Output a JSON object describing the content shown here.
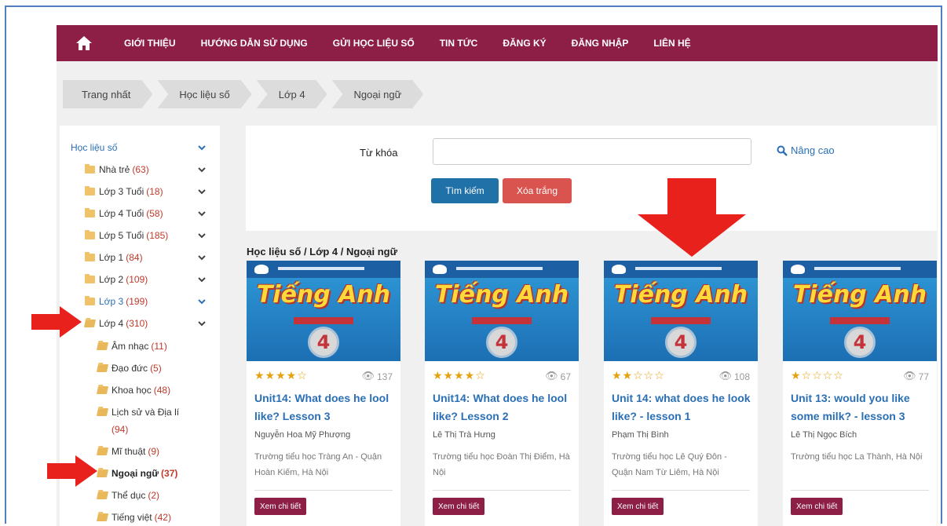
{
  "nav": {
    "items": [
      "GIỚI THIỆU",
      "HƯỚNG DẪN SỬ DỤNG",
      "GỬI HỌC LIỆU SỐ",
      "TIN TỨC",
      "ĐĂNG KÝ",
      "ĐĂNG NHẬP",
      "LIÊN HỆ"
    ]
  },
  "breadcrumb": [
    "Trang nhất",
    "Học liệu số",
    "Lớp 4",
    "Ngoại ngữ"
  ],
  "sidebar": {
    "root": "Học liệu số",
    "items": [
      {
        "label": "Nhà trẻ",
        "count": "(63)"
      },
      {
        "label": "Lớp 3 Tuổi",
        "count": "(18)"
      },
      {
        "label": "Lớp 4 Tuổi",
        "count": "(58)"
      },
      {
        "label": "Lớp 5 Tuổi",
        "count": "(185)"
      },
      {
        "label": "Lớp 1",
        "count": "(84)"
      },
      {
        "label": "Lớp 2",
        "count": "(109)"
      },
      {
        "label": "Lớp 3",
        "count": "(199)"
      },
      {
        "label": "Lớp 4",
        "count": "(310)"
      }
    ],
    "subitems": [
      {
        "label": "Âm nhạc",
        "count": "(11)"
      },
      {
        "label": "Đạo đức",
        "count": "(5)"
      },
      {
        "label": "Khoa học",
        "count": "(48)"
      },
      {
        "label": "Lịch sử và Địa lí",
        "count": "(94)"
      },
      {
        "label": "Mĩ thuật",
        "count": "(9)"
      },
      {
        "label": "Ngoại ngữ",
        "count": "(37)"
      },
      {
        "label": "Thể dục",
        "count": "(2)"
      },
      {
        "label": "Tiếng việt",
        "count": "(42)"
      }
    ]
  },
  "search": {
    "keyword_label": "Từ khóa",
    "keyword_value": "",
    "search_button": "Tìm kiếm",
    "clear_button": "Xóa trắng",
    "advanced_link": "Nâng cao"
  },
  "section_title": "Học liệu số / Lớp 4 / Ngoại ngữ",
  "cards": [
    {
      "cover_title": "Tiếng Anh",
      "cover_grade": "4",
      "rating": 4,
      "stars": "★★★★☆",
      "views": "137",
      "title": "Unit14: What does he lool like? Lesson 3",
      "author": "Nguyễn Hoa Mỹ Phượng",
      "school": "Trường tiểu học Tràng An - Quận Hoàn Kiếm, Hà Nội",
      "button": "Xem chi tiết"
    },
    {
      "cover_title": "Tiếng Anh",
      "cover_grade": "4",
      "rating": 4,
      "stars": "★★★★☆",
      "views": "67",
      "title": "Unit14: What does he lool like? Lesson 2",
      "author": "Lê Thị Trà Hưng",
      "school": "Trường tiểu học Đoàn Thị Điểm, Hà Nội",
      "button": "Xem chi tiết"
    },
    {
      "cover_title": "Tiếng Anh",
      "cover_grade": "4",
      "rating": 2,
      "stars": "★★☆☆☆",
      "views": "108",
      "title": "Unit 14: what does he look like? - lesson 1",
      "author": "Phạm Thị Bình",
      "school": "Trường tiểu học Lê Quý Đôn - Quận Nam Từ Liêm, Hà Nội",
      "button": "Xem chi tiết"
    },
    {
      "cover_title": "Tiếng Anh",
      "cover_grade": "4",
      "rating": 1,
      "stars": "★☆☆☆☆",
      "views": "77",
      "title": "Unit 13: would you like some milk? - lesson 3",
      "author": "Lê Thị Ngọc Bích",
      "school": "Trường tiểu học La Thành, Hà Nội",
      "button": "Xem chi tiết"
    }
  ],
  "colors": {
    "nav": "#8d1f47",
    "link": "#2a6fb5",
    "count": "#c0392b",
    "annotation_arrow": "#e8211c"
  }
}
